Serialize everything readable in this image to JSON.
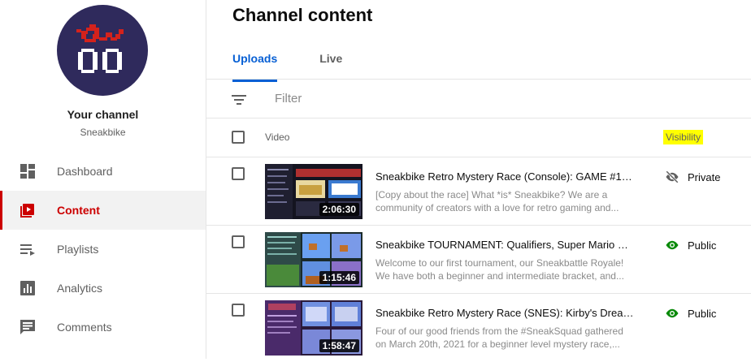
{
  "sidebar": {
    "channel_title": "Your channel",
    "channel_handle": "Sneakbike",
    "items": [
      {
        "label": "Dashboard",
        "icon": "dashboard-icon",
        "active": false
      },
      {
        "label": "Content",
        "icon": "content-icon",
        "active": true
      },
      {
        "label": "Playlists",
        "icon": "playlists-icon",
        "active": false
      },
      {
        "label": "Analytics",
        "icon": "analytics-icon",
        "active": false
      },
      {
        "label": "Comments",
        "icon": "comments-icon",
        "active": false
      }
    ]
  },
  "main": {
    "title": "Channel content",
    "tabs": [
      {
        "label": "Uploads",
        "active": true
      },
      {
        "label": "Live",
        "active": false
      }
    ],
    "filter": {
      "placeholder": "Filter",
      "icon": "filter-icon"
    },
    "table": {
      "headers": {
        "video": "Video",
        "visibility": "Visibility"
      },
      "rows": [
        {
          "title": "Sneakbike Retro Mystery Race (Console): GAME #1, ...",
          "desc1": "[Copy about the race] What *is* Sneakbike? We are a",
          "desc2": "community of creators with a love for retro gaming and...",
          "duration": "2:06:30",
          "visibility": "Private",
          "visibility_icon": "eye-off-icon"
        },
        {
          "title": "Sneakbike TOURNAMENT: Qualifiers, Super Mario Br...",
          "desc1": "Welcome to our first tournament, our Sneakbattle Royale!",
          "desc2": "We have both a beginner and intermediate bracket, and...",
          "duration": "1:15:46",
          "visibility": "Public",
          "visibility_icon": "eye-icon"
        },
        {
          "title": "Sneakbike Retro Mystery Race (SNES): Kirby's Dream...",
          "desc1": "Four of our good friends from the #SneakSquad gathered",
          "desc2": "on March 20th, 2021 for a beginner level mystery race,...",
          "duration": "1:58:47",
          "visibility": "Public",
          "visibility_icon": "eye-icon"
        }
      ]
    }
  },
  "colors": {
    "accent_red": "#cc0000",
    "accent_blue": "#065fd4",
    "public_green": "#0a8a0a",
    "highlight": "#ffff00"
  }
}
